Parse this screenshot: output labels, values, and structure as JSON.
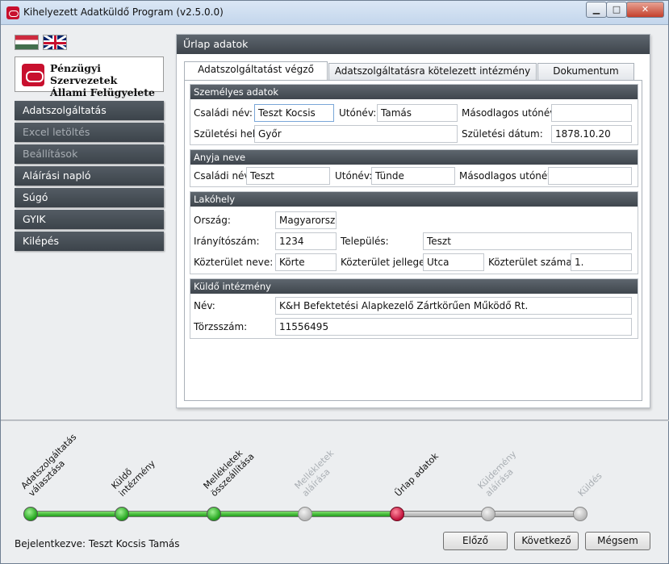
{
  "window": {
    "title": "Kihelyezett Adatküldő Program (v2.5.0.0)",
    "min_symbol": "▁",
    "max_symbol": "□",
    "close_symbol": "✕"
  },
  "logo": {
    "line1": "Pénzügyi Szervezetek",
    "line2": "Állami Felügyelete"
  },
  "nav": [
    {
      "label": "Adatszolgáltatás",
      "enabled": true
    },
    {
      "label": "Excel letöltés",
      "enabled": false
    },
    {
      "label": "Beállítások",
      "enabled": false
    },
    {
      "label": "Aláírási napló",
      "enabled": true
    },
    {
      "label": "Súgó",
      "enabled": true
    },
    {
      "label": "GYIK",
      "enabled": true
    },
    {
      "label": "Kilépés",
      "enabled": true
    }
  ],
  "panel": {
    "title": "Űrlap adatok",
    "tabs": [
      "Adatszolgáltatást végző adatai",
      "Adatszolgáltatásra kötelezett intézmény adatai",
      "Dokumentum adatai"
    ],
    "sections": {
      "personal": {
        "title": "Személyes adatok",
        "family_name_label": "Családi név:",
        "family_name": "Teszt Kocsis",
        "given_name_label": "Utónév:",
        "given_name": "Tamás",
        "second_name_label": "Másodlagos utónév:",
        "second_name": "",
        "birth_place_label": "Születési hely:",
        "birth_place": "Győr",
        "birth_date_label": "Születési dátum:",
        "birth_date": "1878.10.20"
      },
      "mother": {
        "title": "Anyja neve",
        "family_name_label": "Családi név:",
        "family_name": "Teszt",
        "given_name_label": "Utónév:",
        "given_name": "Tünde",
        "second_name_label": "Másodlagos utónév:",
        "second_name": ""
      },
      "address": {
        "title": "Lakóhely",
        "country_label": "Ország:",
        "country": "Magyarország",
        "zip_label": "Irányítószám:",
        "zip": "1234",
        "city_label": "Település:",
        "city": "Teszt",
        "street_label": "Közterület neve:",
        "street": "Körte",
        "street_type_label": "Közterület jellege:",
        "street_type": "Utca",
        "house_no_label": "Közterület száma:",
        "house_no": "1."
      },
      "sender": {
        "title": "Küldő intézmény",
        "name_label": "Név:",
        "name": "K&H Befektetési Alapkezelő Zártkörűen Működő Rt.",
        "reg_label": "Törzsszám:",
        "reg": "11556495"
      }
    }
  },
  "steps": [
    {
      "label1": "Adatszolgáltatás",
      "label2": "választása",
      "state": "done"
    },
    {
      "label1": "Küldő",
      "label2": "intézmény",
      "state": "done"
    },
    {
      "label1": "Mellékletek",
      "label2": "összeállítása",
      "state": "done"
    },
    {
      "label1": "Mellékletek",
      "label2": "aláírása",
      "state": "todo"
    },
    {
      "label1": "Űrlap adatok",
      "label2": "",
      "state": "current"
    },
    {
      "label1": "Küldemény",
      "label2": "aláírása",
      "state": "todo"
    },
    {
      "label1": "Küldés",
      "label2": "",
      "state": "todo"
    }
  ],
  "status": {
    "logged_in": "Bejelentkezve: Teszt Kocsis Tamás"
  },
  "buttons": {
    "prev": "Előző",
    "next": "Következő",
    "cancel": "Mégsem"
  },
  "colors": {
    "accent_red": "#c8102e",
    "step_done": "#2db82a",
    "step_todo": "#b8b8b8",
    "dark_header": "#4a5158"
  }
}
